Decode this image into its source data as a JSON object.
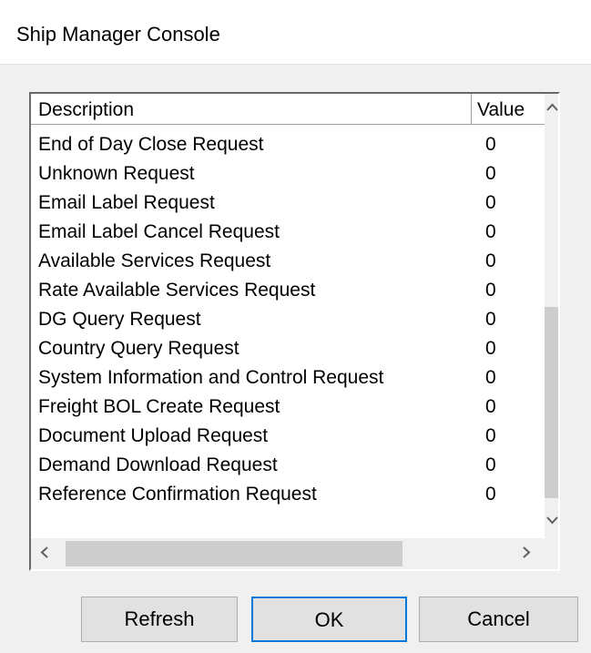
{
  "window": {
    "title": "Ship Manager Console"
  },
  "list": {
    "columns": {
      "description": "Description",
      "value": "Value"
    },
    "rows": [
      {
        "description": "End of Day Close Request",
        "value": "0"
      },
      {
        "description": "Unknown Request",
        "value": "0"
      },
      {
        "description": "Email Label Request",
        "value": "0"
      },
      {
        "description": "Email Label Cancel Request",
        "value": "0"
      },
      {
        "description": "Available Services Request",
        "value": "0"
      },
      {
        "description": "Rate Available Services Request",
        "value": "0"
      },
      {
        "description": "DG Query Request",
        "value": "0"
      },
      {
        "description": "Country Query Request",
        "value": "0"
      },
      {
        "description": "System Information and Control Request",
        "value": "0"
      },
      {
        "description": "Freight BOL Create Request",
        "value": "0"
      },
      {
        "description": "Document Upload Request",
        "value": "0"
      },
      {
        "description": "Demand Download Request",
        "value": "0"
      },
      {
        "description": "Reference Confirmation Request",
        "value": "0"
      }
    ],
    "scroll": {
      "up": "^",
      "down": "v",
      "left": "<",
      "right": ">"
    }
  },
  "buttons": {
    "refresh": "Refresh",
    "ok": "OK",
    "cancel": "Cancel"
  },
  "colors": {
    "accent": "#0078d7",
    "scroll_thumb": "#cdcdcd"
  }
}
